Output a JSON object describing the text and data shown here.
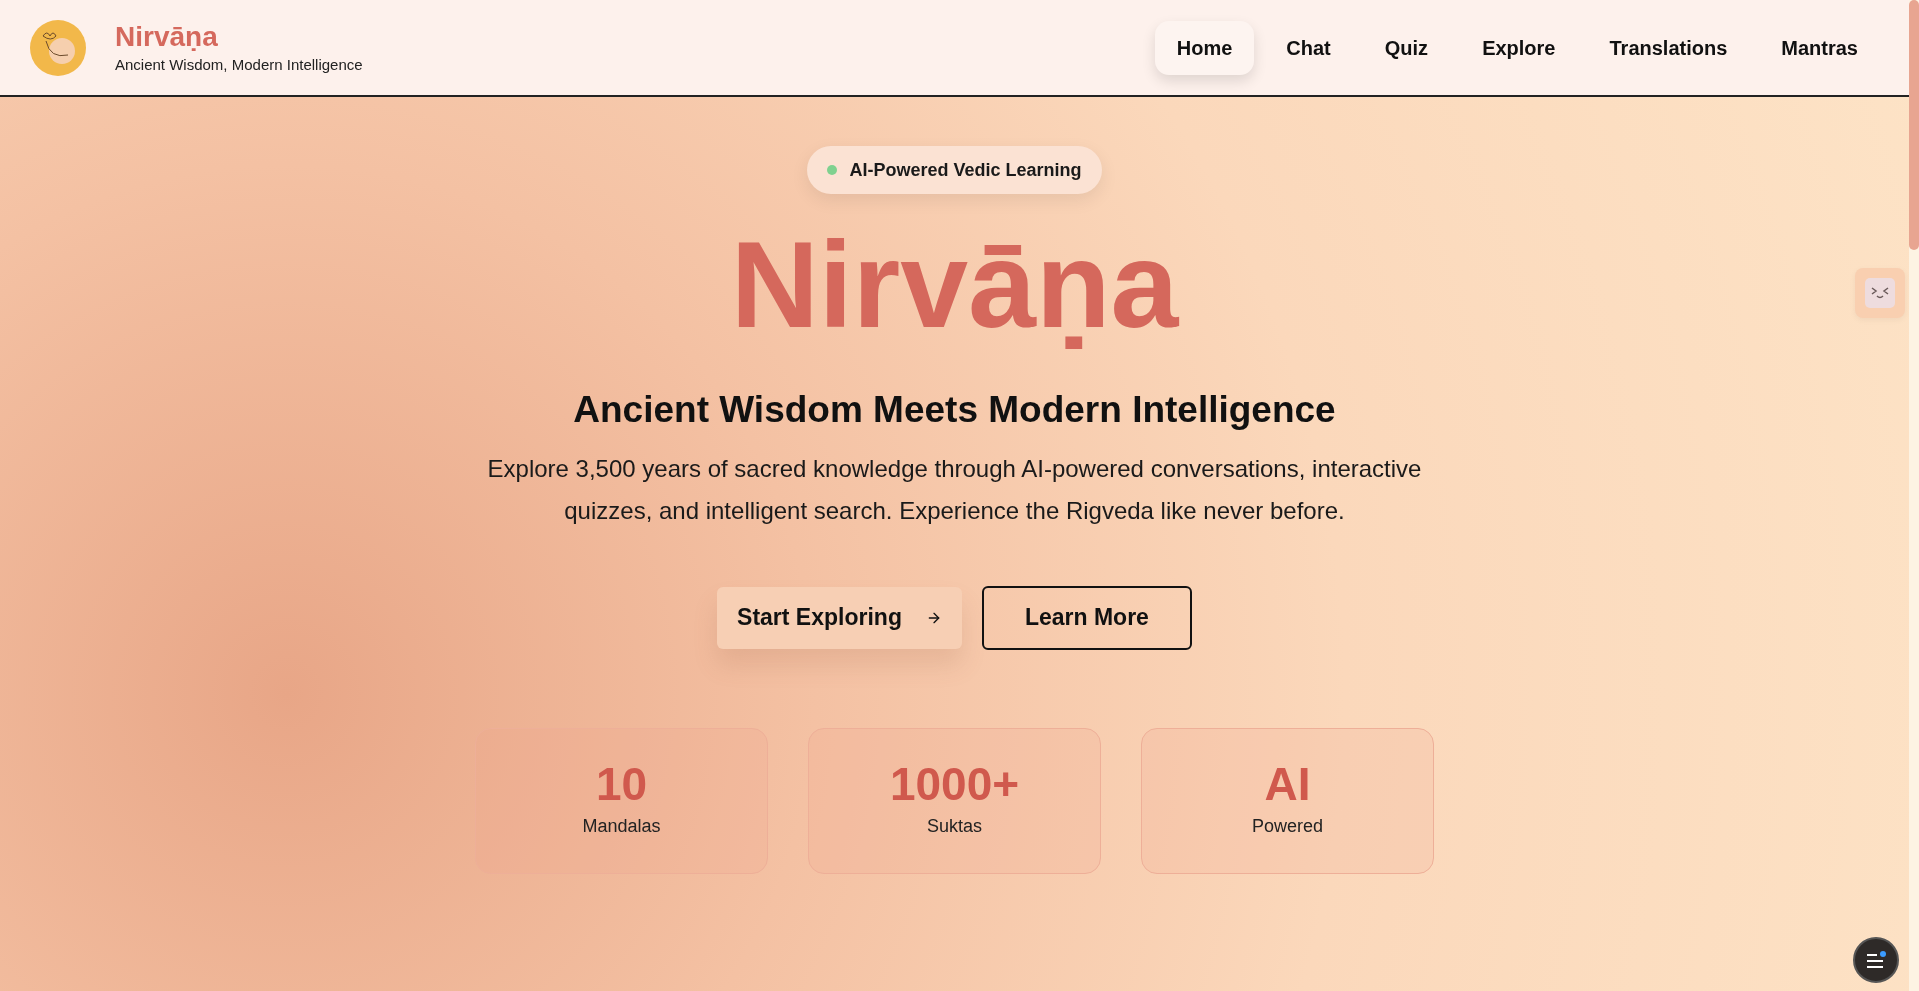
{
  "header": {
    "brand": "Nirvāṇa",
    "tagline": "Ancient Wisdom, Modern Intelligence"
  },
  "nav": [
    {
      "label": "Home",
      "selected": true
    },
    {
      "label": "Chat",
      "selected": false
    },
    {
      "label": "Quiz",
      "selected": false
    },
    {
      "label": "Explore",
      "selected": false
    },
    {
      "label": "Translations",
      "selected": false
    },
    {
      "label": "Mantras",
      "selected": false
    }
  ],
  "hero": {
    "badge": "AI-Powered Vedic Learning",
    "title": "Nirvāṇa",
    "subtitle": "Ancient Wisdom Meets Modern Intelligence",
    "description": "Explore 3,500 years of sacred knowledge through AI-powered conversations, interactive quizzes, and intelligent search. Experience the Rigveda like never before.",
    "buttons": [
      {
        "label": "Start Exploring",
        "kind": "primary"
      },
      {
        "label": "Learn More",
        "kind": "outline"
      }
    ]
  },
  "stats": [
    {
      "value": "10",
      "label": "Mandalas"
    },
    {
      "value": "1000+",
      "label": "Suktas"
    },
    {
      "value": "AI",
      "label": "Powered"
    }
  ]
}
